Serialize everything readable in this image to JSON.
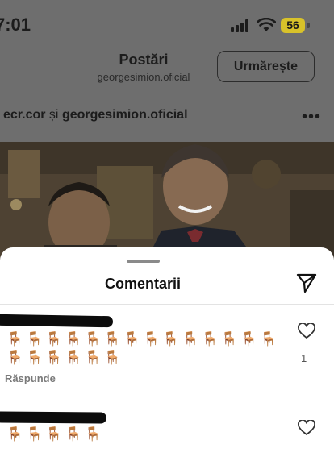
{
  "status_bar": {
    "time": "7:01",
    "battery_level": "56",
    "battery_color": "#d8c22a"
  },
  "header": {
    "title": "Postări",
    "username": "georgesimion.oficial",
    "follow_label": "Urmărește"
  },
  "post": {
    "author_1": "ecr.cor",
    "joiner": " și ",
    "author_2": "georgesimion.oficial",
    "more_label": "•••"
  },
  "comments_sheet": {
    "title": "Comentarii",
    "comments": [
      {
        "text": "🪑🪑🪑🪑🪑🪑🪑🪑🪑🪑🪑🪑🪑🪑🪑🪑🪑🪑🪑🪑",
        "reply_label": "Răspunde",
        "likes": "1"
      },
      {
        "text": "🪑🪑🪑🪑🪑"
      }
    ]
  },
  "icons": {
    "signal": "signal-icon",
    "wifi": "wifi-icon",
    "send": "send-icon",
    "like": "heart-icon",
    "more": "more-icon"
  },
  "colors": {
    "sheet_background": "#ffffff",
    "dim_overlay": "#6e6e6e",
    "chair_emoji": "#8a4a20"
  }
}
